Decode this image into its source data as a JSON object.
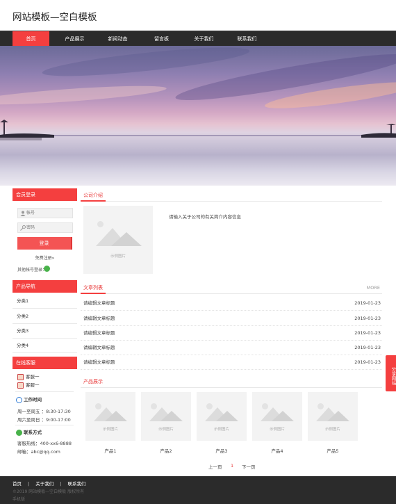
{
  "site": {
    "title": "网站模板—空白模板"
  },
  "nav": {
    "items": [
      "首页",
      "产品展示",
      "新闻动态",
      "留言板",
      "关于我们",
      "联系我们"
    ],
    "active": 0,
    "accent": "#f43f3f",
    "bg": "#2b2b2b"
  },
  "login": {
    "title": "会员登录",
    "username_placeholder": "帐号",
    "password_placeholder": "密码",
    "button": "登录",
    "register": "免费注册»",
    "other_login": "其他帐号登录："
  },
  "product_nav": {
    "title": "产品导航",
    "items": [
      "分类1",
      "分类2",
      "分类3",
      "分类4"
    ]
  },
  "online_service": {
    "title": "在线客服",
    "agents": [
      "客服一",
      "客服一"
    ],
    "work_time_title": "工作时间",
    "work_time_lines": [
      "周一至周五 ：8:30-17:30",
      "周六至周日 ：9:00-17:00"
    ],
    "contact_title": "联系方式",
    "contact_lines": [
      "客服热线：400-xx6-8888",
      "邮箱：abc@qq.com"
    ]
  },
  "company": {
    "title": "公司介绍",
    "image_caption": "示例图片",
    "text": "请输入关于公司的有关简介内容信息"
  },
  "articles": {
    "title": "文章列表",
    "more": "MORE",
    "items": [
      {
        "title": "请编辑文章标题",
        "date": "2019-01-23"
      },
      {
        "title": "请编辑文章标题",
        "date": "2019-01-23"
      },
      {
        "title": "请编辑文章标题",
        "date": "2019-01-23"
      },
      {
        "title": "请编辑文章标题",
        "date": "2019-01-23"
      },
      {
        "title": "请编辑文章标题",
        "date": "2019-01-23"
      }
    ]
  },
  "products": {
    "title": "产品展示",
    "image_caption": "示例图片",
    "items": [
      "产品1",
      "产品2",
      "产品3",
      "产品4",
      "产品5"
    ]
  },
  "pager": {
    "prev": "上一页",
    "current": "1",
    "next": "下一页"
  },
  "share": {
    "label": "分享网站"
  },
  "footer": {
    "links": [
      "首页",
      "关于我们",
      "联系我们"
    ],
    "copyright": "©2019 网站模板—空白模板 版权所有",
    "mobile": "手机版"
  },
  "icons": {
    "user": "user-icon",
    "key": "key-icon",
    "wechat": "wechat-icon",
    "clock": "clock-icon",
    "phone": "contact-icon"
  }
}
